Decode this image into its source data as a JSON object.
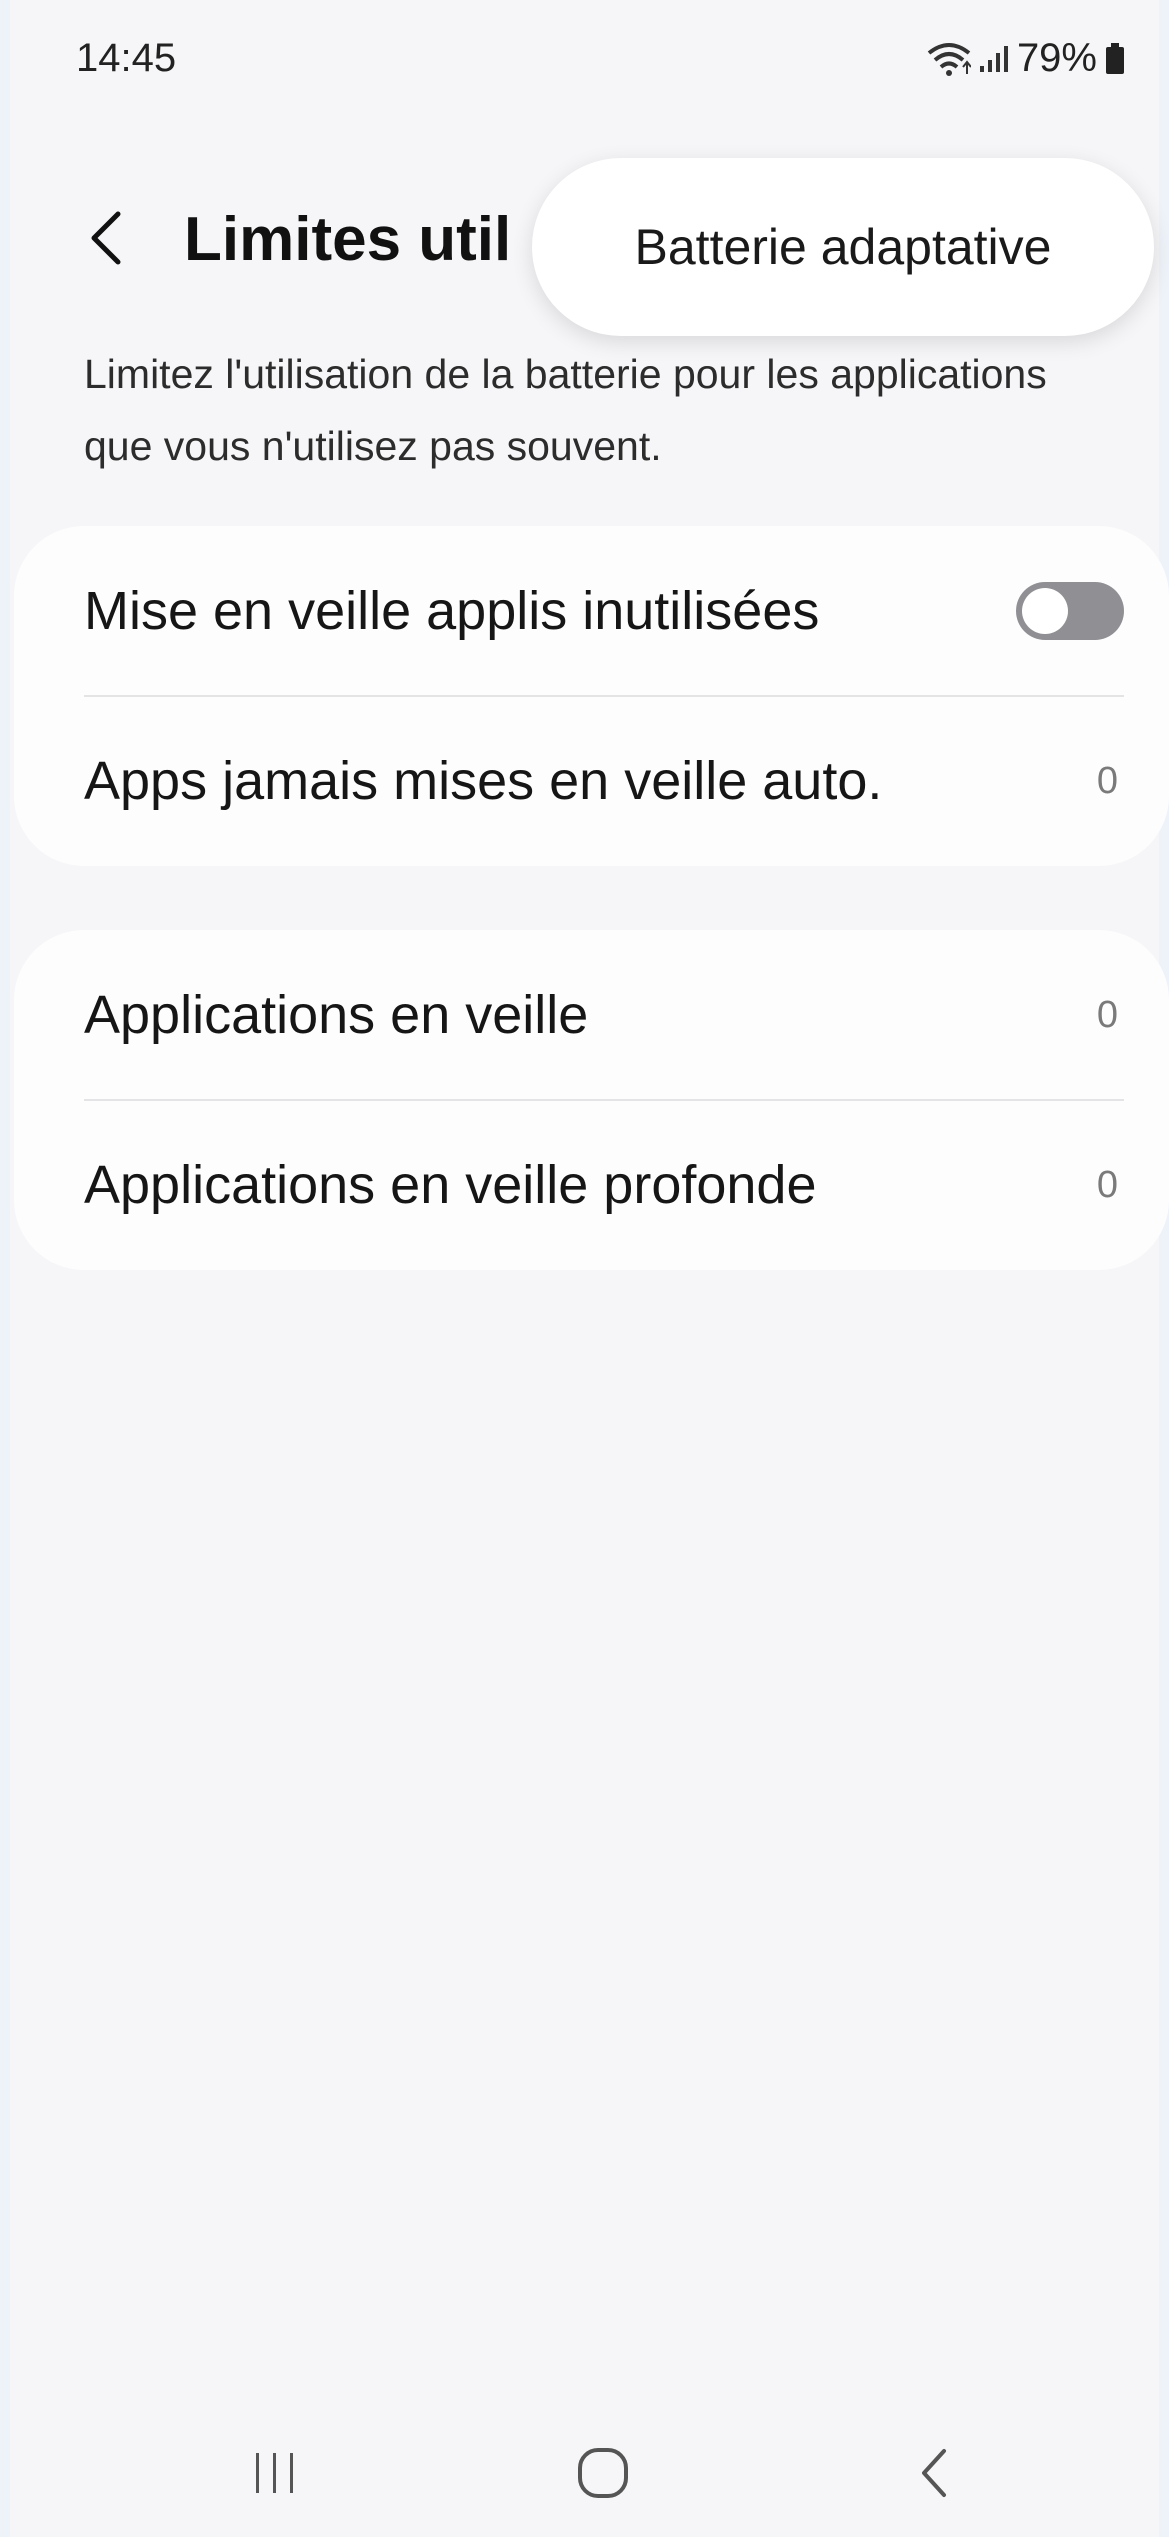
{
  "status_bar": {
    "time": "14:45",
    "battery_text": "79%",
    "icons": [
      "wifi-icon",
      "signal-icon",
      "battery-icon"
    ]
  },
  "header": {
    "title": "Limites util",
    "back_icon": "chevron-left-icon"
  },
  "popup": {
    "label": "Batterie adaptative"
  },
  "description": "Limitez l'utilisation de la batterie pour les applications que vous n'utilisez pas souvent.",
  "card_1": {
    "rows": [
      {
        "label": "Mise en veille applis inutilisées",
        "toggle_on": false
      },
      {
        "label": "Apps jamais mises en veille auto.",
        "value": "0"
      }
    ]
  },
  "card_2": {
    "rows": [
      {
        "label": "Applications en veille",
        "value": "0"
      },
      {
        "label": "Applications en veille profonde",
        "value": "0"
      }
    ]
  },
  "nav": {
    "icons": [
      "recent-apps-icon",
      "home-icon",
      "back-icon"
    ]
  },
  "colors": {
    "background": "#f6f6f8",
    "card": "#fdfdfe",
    "toggle_off": "#8f8f94"
  }
}
